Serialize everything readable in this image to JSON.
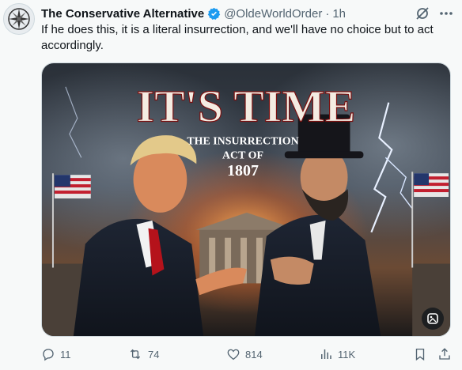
{
  "tweet": {
    "author": {
      "name": "The Conservative Alternative",
      "handle": "@OldeWorldOrder",
      "verified": true,
      "avatar_icon": "compass-emblem-icon"
    },
    "separator": "·",
    "time": "1h",
    "body": "If he does this, it is a literal insurrection, and we'll have no choice but to act accordingly.",
    "media": {
      "headline": "IT'S TIME",
      "subtitle_line1": "THE INSURRECTION",
      "subtitle_line2": "ACT OF",
      "subtitle_line3": "1807"
    },
    "stats": {
      "replies": "11",
      "reposts": "74",
      "likes": "814",
      "views": "11K"
    },
    "colors": {
      "accent": "#1d9bf0",
      "text": "#0f1419",
      "muted": "#536471",
      "repost_green": "#00ba7c"
    }
  }
}
